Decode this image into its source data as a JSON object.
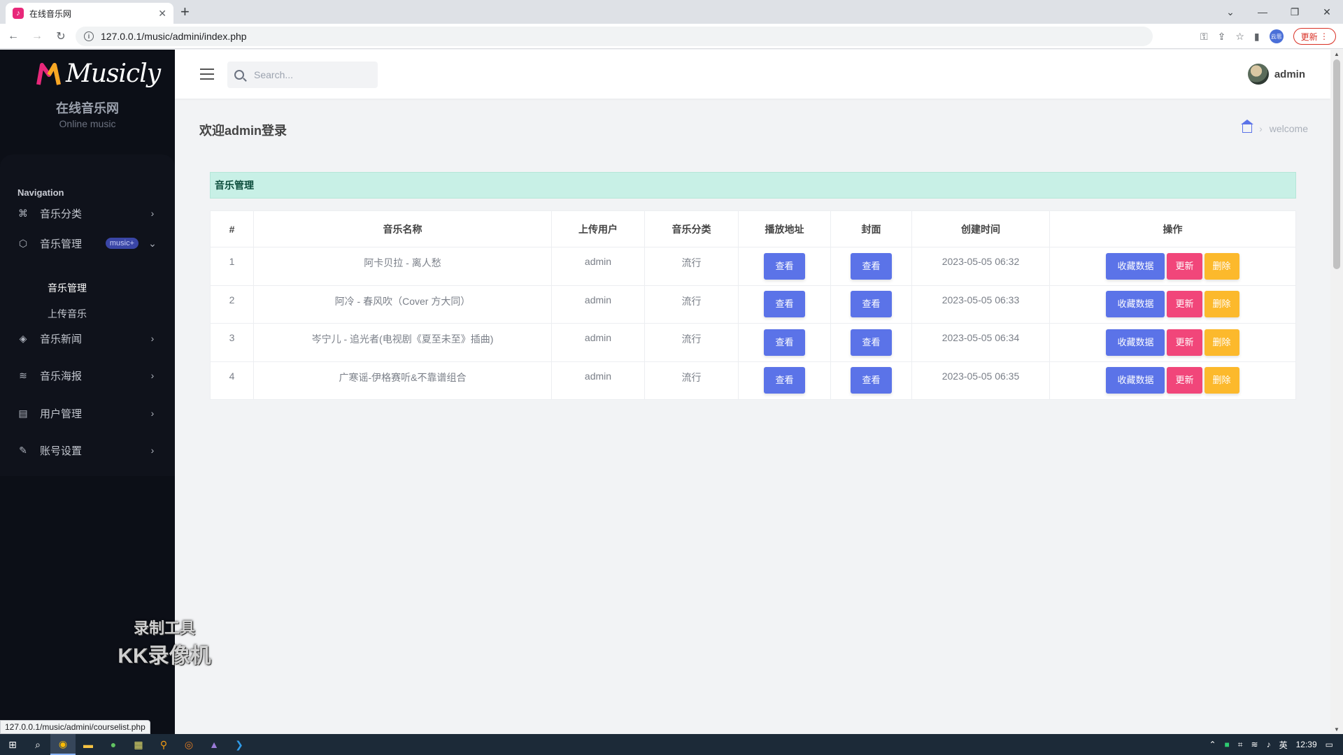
{
  "browser": {
    "tab_title": "在线音乐网",
    "tab_favicon": "music-favicon",
    "url": "127.0.0.1/music/admini/index.php",
    "update_label": "更新",
    "profile_label": "云思",
    "status_url": "127.0.0.1/music/admini/courselist.php"
  },
  "brand": {
    "logo_text": "Musicly",
    "name_cn": "在线音乐网",
    "name_en": "Online music"
  },
  "sidebar": {
    "heading": "Navigation",
    "items": [
      {
        "label": "音乐分类",
        "icon": "command-icon"
      },
      {
        "label": "音乐管理",
        "icon": "box-icon",
        "badge": "music+"
      },
      {
        "label": "音乐新闻",
        "icon": "layers-icon"
      },
      {
        "label": "音乐海报",
        "icon": "wifi-off-icon"
      },
      {
        "label": "用户管理",
        "icon": "document-icon"
      },
      {
        "label": "账号设置",
        "icon": "feather-icon"
      }
    ],
    "sub_items": [
      "音乐管理",
      "上传音乐"
    ]
  },
  "watermark": {
    "line1": "录制工具",
    "line2": "KK录像机"
  },
  "topbar": {
    "search_placeholder": "Search...",
    "user_name": "admin"
  },
  "page": {
    "title": "欢迎admin登录",
    "breadcrumb_current": "welcome",
    "card_title": "音乐管理"
  },
  "table": {
    "headers": [
      "#",
      "音乐名称",
      "上传用户",
      "音乐分类",
      "播放地址",
      "封面",
      "创建时间",
      "操作"
    ],
    "view_label": "查看",
    "collect_label": "收藏数据",
    "update_label": "更新",
    "delete_label": "删除",
    "rows": [
      {
        "id": "1",
        "name": "阿卡贝拉 - 离人愁",
        "user": "admin",
        "category": "流行",
        "created": "2023-05-05 06:32"
      },
      {
        "id": "2",
        "name": "阿冷 - 春风吹（Cover 方大同）",
        "user": "admin",
        "category": "流行",
        "created": "2023-05-05 06:33"
      },
      {
        "id": "3",
        "name": "岑宁儿 - 追光者(电视剧《夏至未至》插曲)",
        "user": "admin",
        "category": "流行",
        "created": "2023-05-05 06:34"
      },
      {
        "id": "4",
        "name": "广寒谣-伊格赛听&不靠谱组合",
        "user": "admin",
        "category": "流行",
        "created": "2023-05-05 06:35"
      }
    ]
  },
  "taskbar": {
    "clock": "12:39",
    "ime": "英"
  },
  "colors": {
    "sidebar_bg": "#0c0f17",
    "primary": "#5b73e8",
    "danger": "#f1467a",
    "warning": "#fcb92c",
    "card_header_bg": "#c8f0e6"
  }
}
